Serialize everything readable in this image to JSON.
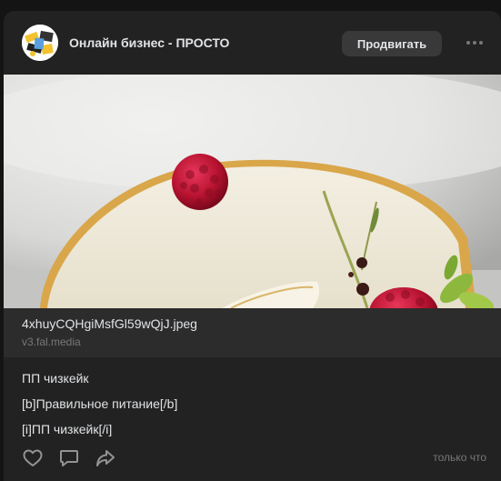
{
  "post": {
    "community_name": "Онлайн бизнес - ПРОСТО",
    "promote_label": "Продвигать",
    "link": {
      "title": "4xhuyCQHgiMsfGl59wQjJ.jpeg",
      "domain": "v3.fal.media"
    },
    "text_lines": [
      "ПП чизкейк",
      "[b]Правильное питание[/b]",
      "[i]ПП чизкейк[/i]"
    ],
    "timestamp": "только что"
  },
  "icons": {
    "more": "more-horizontal-icon",
    "like": "heart-icon",
    "comment": "comment-icon",
    "share": "share-icon"
  },
  "colors": {
    "card_bg": "#222222",
    "link_bg": "#2c2c2c",
    "button_bg": "#393939",
    "muted_text": "#76787a"
  }
}
